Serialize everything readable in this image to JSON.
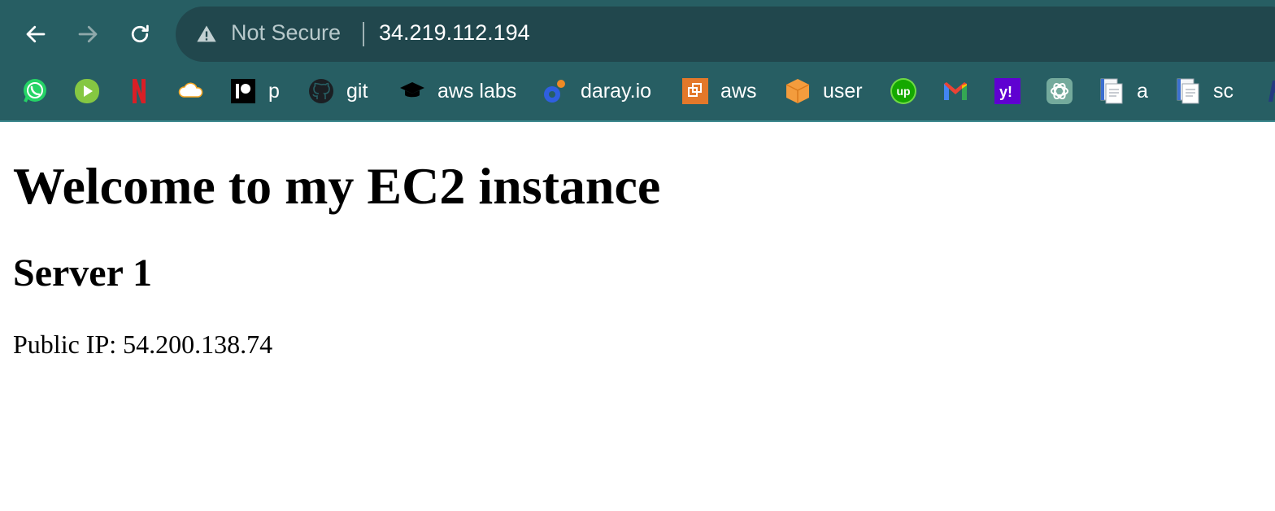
{
  "browser": {
    "security_label": "Not Secure",
    "url": "34.219.112.194",
    "nav_icons": [
      "back-arrow-icon",
      "forward-arrow-icon",
      "reload-icon"
    ],
    "bookmarks": [
      {
        "icon": "whatsapp-icon",
        "label": ""
      },
      {
        "icon": "rumble-icon",
        "label": ""
      },
      {
        "icon": "netflix-icon",
        "label": ""
      },
      {
        "icon": "cloud-icon",
        "label": ""
      },
      {
        "icon": "patreon-icon",
        "label": "p"
      },
      {
        "icon": "github-icon",
        "label": "git"
      },
      {
        "icon": "graduation-cap-icon",
        "label": "aws labs"
      },
      {
        "icon": "daray-icon",
        "label": "daray.io"
      },
      {
        "icon": "aws-icon",
        "label": "aws"
      },
      {
        "icon": "box-icon",
        "label": "user"
      },
      {
        "icon": "upwork-icon",
        "label": ""
      },
      {
        "icon": "gmail-icon",
        "label": ""
      },
      {
        "icon": "yahoo-icon",
        "label": ""
      },
      {
        "icon": "openai-icon",
        "label": ""
      },
      {
        "icon": "document-icon",
        "label": "a"
      },
      {
        "icon": "document-icon",
        "label": "sc"
      }
    ],
    "colors": {
      "toolbar_bg": "#275e63",
      "omnibox_bg": "#21474d"
    }
  },
  "page": {
    "heading": "Welcome to my EC2 instance",
    "subheading": "Server 1",
    "public_ip_text": "Public IP: 54.200.138.74"
  }
}
